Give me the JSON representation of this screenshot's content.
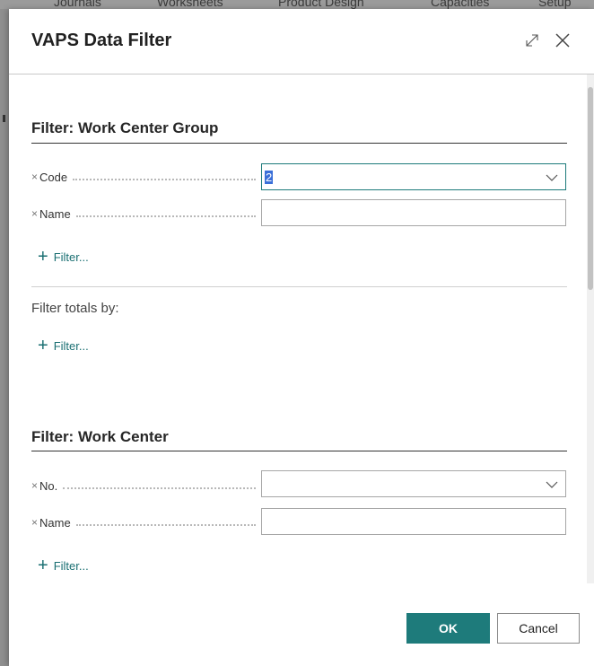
{
  "background": {
    "nav_items": [
      "Journals",
      "Worksheets",
      "Product Design",
      "Capacities",
      "Setup"
    ]
  },
  "dialog": {
    "title": "VAPS Data Filter",
    "expand_icon": "expand-icon",
    "close_icon": "close-icon"
  },
  "sections": {
    "work_center_group": {
      "title": "Filter: Work Center Group",
      "fields": {
        "code": {
          "remove": "×",
          "label": "Code",
          "value": "2"
        },
        "name": {
          "remove": "×",
          "label": "Name",
          "value": ""
        }
      },
      "add_filter_label": "Filter..."
    },
    "totals": {
      "label": "Filter totals by:",
      "add_filter_label": "Filter..."
    },
    "work_center": {
      "title": "Filter: Work Center",
      "fields": {
        "no": {
          "remove": "×",
          "label": "No.",
          "value": ""
        },
        "name": {
          "remove": "×",
          "label": "Name",
          "value": ""
        }
      },
      "add_filter_label": "Filter..."
    }
  },
  "footer": {
    "ok_label": "OK",
    "cancel_label": "Cancel"
  },
  "colors": {
    "accent": "#1e7b7b",
    "link": "#1a6f72",
    "selection": "#3a6fd8"
  }
}
